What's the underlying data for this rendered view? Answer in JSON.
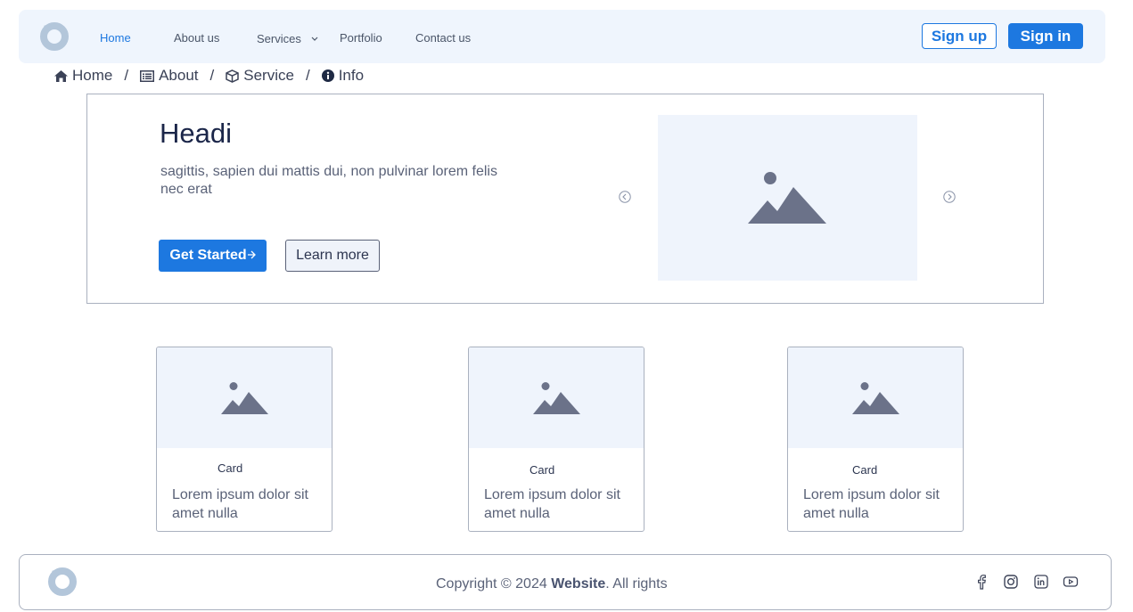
{
  "colors": {
    "accent": "#1d78e0",
    "nav_bg": "#eff5fd",
    "placeholder_bg": "#eff4fc",
    "placeholder_icon": "#6b7289"
  },
  "navbar": {
    "logo_icon": "logo-ring-icon",
    "links": [
      {
        "label": "Home",
        "active": true
      },
      {
        "label": "About us"
      },
      {
        "label": "Services",
        "has_dropdown": true
      },
      {
        "label": "Portfolio"
      },
      {
        "label": "Contact us"
      }
    ],
    "signup_label": "Sign up",
    "signin_label": "Sign in"
  },
  "breadcrumb": {
    "separator": "/",
    "items": [
      {
        "label": "Home",
        "icon": "home-icon"
      },
      {
        "label": "About",
        "icon": "list-icon"
      },
      {
        "label": "Service",
        "icon": "box-icon"
      },
      {
        "label": "Info",
        "icon": "info-icon"
      }
    ]
  },
  "hero": {
    "title": "Headi",
    "description": " sagittis, sapien dui mattis dui, non pulvinar lorem felis nec erat",
    "primary_button": "Get Started",
    "secondary_button": "Learn more",
    "image_icon": "image-placeholder-icon"
  },
  "cards": [
    {
      "title": "Card",
      "text": "Lorem ipsum dolor sit amet nulla"
    },
    {
      "title": "Card",
      "text": "Lorem ipsum dolor sit amet nulla"
    },
    {
      "title": "Card",
      "text": "Lorem ipsum dolor sit amet nulla"
    }
  ],
  "footer": {
    "copyright_prefix": "Copyright © 2024 ",
    "copyright_brand": "Website",
    "copyright_suffix": ". All rights",
    "social": [
      "facebook-icon",
      "instagram-icon",
      "linkedin-icon",
      "youtube-icon"
    ]
  }
}
